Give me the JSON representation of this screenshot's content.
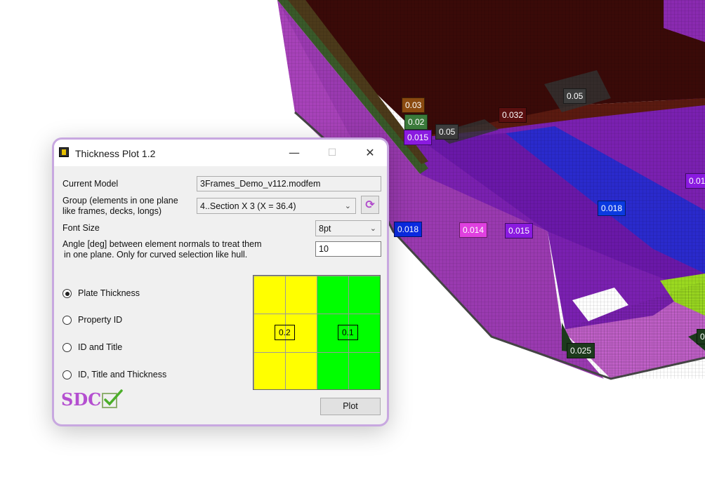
{
  "window": {
    "title": "Thickness Plot 1.2",
    "controls": {
      "minimize": "—",
      "maximize": "☐",
      "close": "✕"
    }
  },
  "form": {
    "current_model_label": "Current Model",
    "current_model_value": "3Frames_Demo_v112.modfem",
    "group_label_line1": "Group (elements in one plane",
    "group_label_line2": "like frames, decks, longs)",
    "group_value": "4..Section X 3 (X = 36.4)",
    "font_size_label": "Font Size",
    "font_size_value": "8pt",
    "angle_label_line1": "Angle [deg] between element normals to treat them",
    "angle_label_line2": "in one plane. Only for curved selection like hull.",
    "angle_value": "10"
  },
  "radio_options": [
    {
      "label": "Plate Thickness",
      "selected": true
    },
    {
      "label": "Property ID",
      "selected": false
    },
    {
      "label": "ID and Title",
      "selected": false
    },
    {
      "label": "ID, Title and Thickness",
      "selected": false
    }
  ],
  "preview": {
    "left_value": "0.2",
    "right_value": "0.1",
    "left_color": "#ffff00",
    "right_color": "#00ff00"
  },
  "logo_text": "SDC",
  "plot_button": "Plot",
  "fem_labels": [
    "0.03",
    "0.02",
    "0.015",
    "0.05",
    "0.032",
    "0.05",
    "0.018",
    "0.014",
    "0.015",
    "0.018",
    "0.01",
    "0.025",
    "0"
  ],
  "colors": {
    "hull_purple": "#7a1fa0",
    "deck_blue": "#2a2acc",
    "accent_violet": "#b44fd0"
  }
}
